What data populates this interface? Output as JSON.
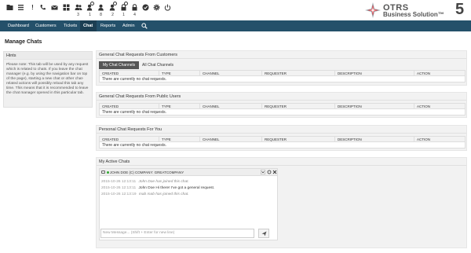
{
  "toolbar": {
    "icons": [
      {
        "name": "folder-icon",
        "glyph": "▬"
      },
      {
        "name": "list-icon",
        "glyph": "☰"
      },
      {
        "name": "exclamation-icon",
        "glyph": "!"
      },
      {
        "name": "phone-icon",
        "glyph": "✆"
      },
      {
        "name": "mail-icon",
        "glyph": "✉"
      },
      {
        "name": "grid-icon",
        "glyph": "▦"
      },
      {
        "name": "users-icon",
        "glyph": "👥",
        "count": "3"
      },
      {
        "name": "user-clock-icon",
        "glyph": "👤",
        "count": "1"
      },
      {
        "name": "user-icon",
        "glyph": "👤",
        "count": "8"
      },
      {
        "name": "user-star-icon",
        "glyph": "👤",
        "count": "2"
      },
      {
        "name": "lock-clock-icon",
        "glyph": "🔒",
        "count": "1"
      },
      {
        "name": "lock-icon",
        "glyph": "🔒",
        "count": "4"
      },
      {
        "name": "check-circle-icon",
        "glyph": "✔"
      },
      {
        "name": "gear-icon",
        "glyph": "⚙"
      },
      {
        "name": "power-icon",
        "glyph": "⏻"
      }
    ]
  },
  "logo": {
    "line1": "OTRS",
    "line2": "Business Solution™",
    "version": "5"
  },
  "nav": {
    "items": [
      "Dashboard",
      "Customers",
      "Tickets",
      "Chat",
      "Reports",
      "Admin"
    ],
    "active": "Chat"
  },
  "page": {
    "title": "Manage Chats"
  },
  "hints": {
    "title": "Hints",
    "text": "Please note: This tab will be used by any request which is related to chats. If you leave the chat manager (e.g. by using the navigation bar on top of the page), starting a new chat or other chat-related actions will possibly reload this tab any time. This means that it is recommended to leave the chat manager opened in this particular tab."
  },
  "columns": [
    "CREATED",
    "TYPE",
    "CHANNEL",
    "REQUESTER",
    "DESCRIPTION",
    "ACTION"
  ],
  "empty_message": "There are currently no chat requests.",
  "panels": {
    "customers": {
      "title": "General Chat Requests From Customers",
      "tabs": [
        "My Chat Channels",
        "All Chat Channels"
      ]
    },
    "public": {
      "title": "General Chat Requests From Public Users"
    },
    "personal": {
      "title": "Personal Chat Requests For You"
    },
    "active": {
      "title": "My Active Chats"
    }
  },
  "chat": {
    "name": "JOHN DOE (C) COMPANY: GREATCOMPANY",
    "messages": [
      {
        "ts": "2015-10-26 12:13:11",
        "who": "",
        "text": "John Doe has joined this chat.",
        "system": true
      },
      {
        "ts": "2015-10-26 12:13:11",
        "who": "John Doe",
        "text": "Hi there! I've got a general request.",
        "system": false
      },
      {
        "ts": "2015-10-26 12:13:19",
        "who": "",
        "text": "mab mab has joined this chat.",
        "system": true
      }
    ],
    "input_placeholder": "New Message... (Shift + Enter for new line)"
  },
  "colors": {
    "nav_bg": "#24506a",
    "nav_active": "#1c3e52",
    "tab_active": "#555555",
    "online": "#33aa33"
  }
}
